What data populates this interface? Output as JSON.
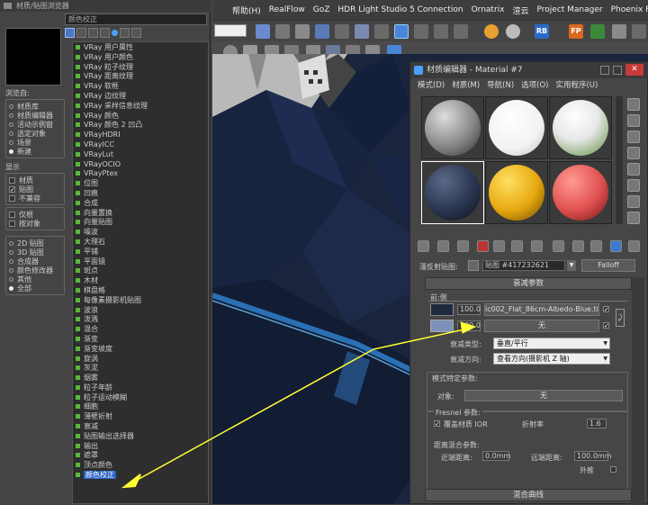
{
  "browser": {
    "title": "材质/贴图浏览器",
    "search_value": "颜色校正",
    "browse_from": {
      "label": "浏览自:",
      "options": [
        {
          "label": "材质库",
          "selected": false
        },
        {
          "label": "材质编辑器",
          "selected": false
        },
        {
          "label": "活动示例窗",
          "selected": false
        },
        {
          "label": "选定对象",
          "selected": false
        },
        {
          "label": "场景",
          "selected": false
        },
        {
          "label": "新建",
          "selected": true
        }
      ]
    },
    "show": {
      "label": "显示",
      "options": [
        {
          "label": "材质",
          "checked": false
        },
        {
          "label": "贴图",
          "checked": true
        },
        {
          "label": "不兼容",
          "checked": false
        }
      ]
    },
    "extra_checks": [
      {
        "label": "仅根",
        "checked": false
      },
      {
        "label": "按对象",
        "checked": false
      }
    ],
    "categories": [
      {
        "label": "2D 贴图",
        "selected": false
      },
      {
        "label": "3D 贴图",
        "selected": false
      },
      {
        "label": "合成器",
        "selected": false
      },
      {
        "label": "颜色修改器",
        "selected": false
      },
      {
        "label": "其他",
        "selected": false
      },
      {
        "label": "全部",
        "selected": true
      }
    ],
    "maps": [
      "VRay 用户属性",
      "VRay 用户颜色",
      "VRay 粒子纹理",
      "VRay 距离纹理",
      "VRay 软框",
      "VRay 边纹理",
      "VRay 采样信息纹理",
      "VRay 颜色",
      "VRay 颜色 2 凹凸",
      "VRayHDRI",
      "VRayICC",
      "VRayLut",
      "VRayOCIO",
      "VRayPtex",
      "位图",
      "凹痕",
      "合成",
      "向量置换",
      "向量贴图",
      "噪波",
      "大理石",
      "平铺",
      "平面镜",
      "斑点",
      "木材",
      "棋盘格",
      "每像素摄影机贴图",
      "波浪",
      "泼溅",
      "混合",
      "渐变",
      "渐变坡度",
      "旋涡",
      "灰泥",
      "烟雾",
      "粒子年龄",
      "粒子运动模糊",
      "细胞",
      "薄壁折射",
      "衰减",
      "贴图输出选择器",
      "输出",
      "遮罩",
      "顶点颜色",
      "颜色校正"
    ],
    "selected_map": "颜色校正"
  },
  "menubar": {
    "items": [
      "帮助(H)",
      "RealFlow",
      "GoZ",
      "HDR Light Studio 5 Connection",
      "Ornatrix",
      "渲云",
      "Project Manager",
      "Phoenix FD"
    ]
  },
  "toolbar": {
    "rb_label": "RB",
    "fp_label": "FP"
  },
  "mated": {
    "title": "材质编辑器 - Material #7",
    "menu": [
      "模式(D)",
      "材质(M)",
      "导航(N)",
      "选项(O)",
      "实用程序(U)"
    ],
    "map_slot_label": "漫反射贴图:",
    "map_name": "贴图 #417232621",
    "map_type": "Falloff",
    "rollout_falloff": "衰减参数",
    "front_side_label": "前:侧",
    "front_amount": "100.0",
    "front_map": "ic002_Flat_86cm-Albedo-Blue.tif)",
    "side_amount": "100.0",
    "side_map": "无",
    "falloff_type_label": "衰减类型:",
    "falloff_type_value": "垂直/平行",
    "falloff_dir_label": "衰减方向:",
    "falloff_dir_value": "查看方向(摄影机 Z 轴)",
    "mode_params_label": "模式特定参数:",
    "object_label": "对象:",
    "object_value": "无",
    "fresnel_label": "Fresnel 参数:",
    "override_ior_label": "覆盖材质 IOR",
    "ior_label": "折射率",
    "ior_value": "1.6",
    "distance_label": "距离混合参数:",
    "near_label": "近端距离:",
    "near_value": "0.0mm",
    "far_label": "远端距离:",
    "far_value": "100.0mm",
    "extrapolate_label": "外推",
    "mix_curve": "混合曲线"
  },
  "colors": {
    "accent": "#2a62c8",
    "arrow": "#ffff33",
    "map_icon": "#5ab83a"
  }
}
